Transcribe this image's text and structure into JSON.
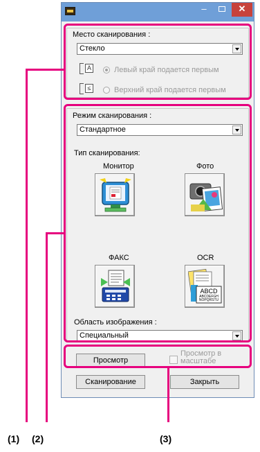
{
  "window": {
    "title_icon": "app-icon",
    "controls": {
      "minimize": "–",
      "close": "✕"
    }
  },
  "scan_location": {
    "label": "Место сканирования :",
    "value": "Стекло",
    "options": [
      {
        "label": "Левый край подается первым",
        "selected": true,
        "icon": "left-edge-icon",
        "icon_letter": "A"
      },
      {
        "label": "Верхний край подается первым",
        "selected": false,
        "icon": "top-edge-icon",
        "icon_letter": "≤"
      }
    ]
  },
  "scan_mode": {
    "label": "Режим сканирования :",
    "value": "Стандартное"
  },
  "scan_type": {
    "label": "Тип сканирования:",
    "items": [
      {
        "label": "Монитор",
        "icon": "monitor-icon"
      },
      {
        "label": "Фото",
        "icon": "photo-icon"
      },
      {
        "label": "ФАКС",
        "icon": "fax-icon"
      },
      {
        "label": "OCR",
        "icon": "ocr-icon",
        "icon_text": [
          "ABCD",
          "ABCDEFGH",
          "NOPQRSTU"
        ]
      }
    ]
  },
  "image_area": {
    "label": "Область изображения :",
    "value": "Специальный"
  },
  "preview": {
    "button": "Просмотр",
    "zoom_checkbox_label": "Просмотр в масштабе",
    "zoom_checked": false
  },
  "actions": {
    "scan": "Сканирование",
    "close": "Закрыть"
  },
  "callouts": {
    "c1": "(1)",
    "c2": "(2)",
    "c3": "(3)",
    "color": "#e6007e"
  }
}
